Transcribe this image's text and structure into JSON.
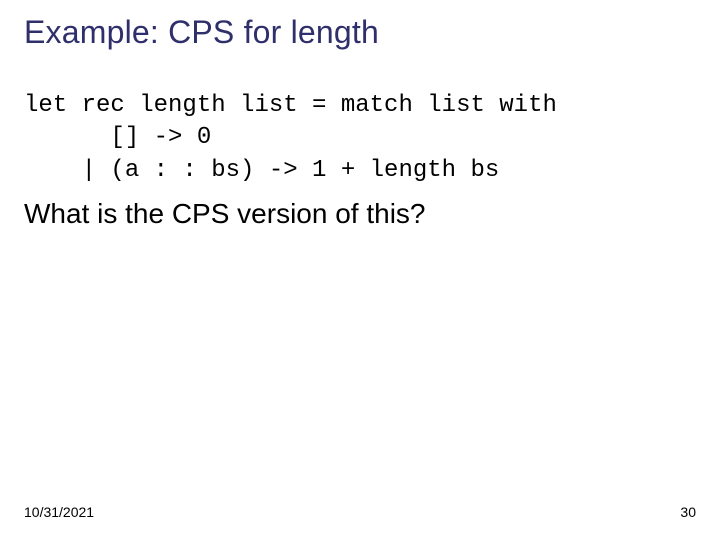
{
  "slide": {
    "title": "Example: CPS for length",
    "code_lines": [
      "let rec length list = match list with",
      "      [] -> 0",
      "    | (a : : bs) -> 1 + length bs"
    ],
    "question": "What is the CPS version of this?",
    "date": "10/31/2021",
    "page_number": "30"
  }
}
